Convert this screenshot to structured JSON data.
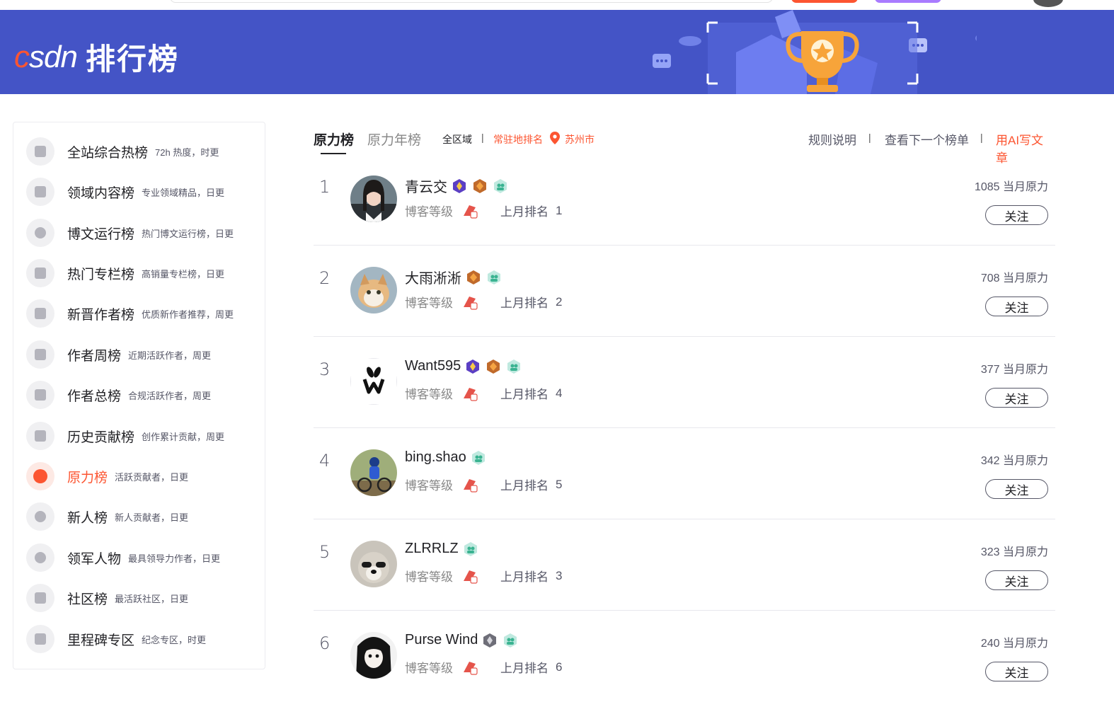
{
  "banner": {
    "logo_text": "CSDN",
    "title": "排行榜"
  },
  "sidebar": {
    "items": [
      {
        "label": "全站综合热榜",
        "desc": "72h 热度，时更",
        "icon": "rocket-icon"
      },
      {
        "label": "领域内容榜",
        "desc": "专业领域精品，日更",
        "icon": "code-icon"
      },
      {
        "label": "博文运行榜",
        "desc": "热门博文运行榜，日更",
        "icon": "play-icon"
      },
      {
        "label": "热门专栏榜",
        "desc": "高销量专栏榜，日更",
        "icon": "book-icon"
      },
      {
        "label": "新晋作者榜",
        "desc": "优质新作者推荐，周更",
        "icon": "user-icon"
      },
      {
        "label": "作者周榜",
        "desc": "近期活跃作者，周更",
        "icon": "calendar-icon"
      },
      {
        "label": "作者总榜",
        "desc": "合规活跃作者，周更",
        "icon": "group-icon"
      },
      {
        "label": "历史贡献榜",
        "desc": "创作累计贡献，周更",
        "icon": "podium-icon"
      },
      {
        "label": "原力榜",
        "desc": "活跃贡献者，日更",
        "icon": "new-badge-icon",
        "active": true
      },
      {
        "label": "新人榜",
        "desc": "新人贡献者，日更",
        "icon": "newcomer-icon"
      },
      {
        "label": "领军人物",
        "desc": "最具领导力作者，日更",
        "icon": "medal-icon"
      },
      {
        "label": "社区榜",
        "desc": "最活跃社区，日更",
        "icon": "community-icon"
      },
      {
        "label": "里程碑专区",
        "desc": "纪念专区，时更",
        "icon": "milestone-icon"
      }
    ]
  },
  "tabs": {
    "active": "原力榜",
    "second": "原力年榜",
    "filter_all": "全区域",
    "separator": "|",
    "filter_resident": "常驻地排名",
    "city": "苏州市",
    "rules": "规则说明",
    "next_list": "查看下一个榜单",
    "ai_write": "用AI写文章"
  },
  "labels": {
    "blog_level": "博客等级",
    "last_month_rank": "上月排名",
    "follow": "关注"
  },
  "colors": {
    "accent": "#fc5531",
    "banner": "#4454c6"
  },
  "rankings": [
    {
      "rank": "1",
      "name": "青云交",
      "badges": [
        "purple-badge",
        "orange-badge",
        "green-badge"
      ],
      "level_icon": "level-9-icon",
      "last_rank": "1",
      "force": "1085 当月原力"
    },
    {
      "rank": "2",
      "name": "大雨淅淅",
      "badges": [
        "orange-badge",
        "green-badge"
      ],
      "level_icon": "level-9-icon",
      "last_rank": "2",
      "force": "708 当月原力"
    },
    {
      "rank": "3",
      "name": "Want595",
      "badges": [
        "purple-badge",
        "orange-badge",
        "green-badge"
      ],
      "level_icon": "level-9-icon",
      "last_rank": "4",
      "force": "377 当月原力"
    },
    {
      "rank": "4",
      "name": "bing.shao",
      "badges": [
        "green-badge"
      ],
      "level_icon": "level-8-icon",
      "last_rank": "5",
      "force": "342 当月原力"
    },
    {
      "rank": "5",
      "name": "ZLRRLZ",
      "badges": [
        "green-badge"
      ],
      "level_icon": "level-6-icon",
      "last_rank": "3",
      "force": "323 当月原力"
    },
    {
      "rank": "6",
      "name": "Purse Wind",
      "badges": [
        "gray-badge",
        "green-badge"
      ],
      "level_icon": "level-5-icon",
      "last_rank": "6",
      "force": "240 当月原力"
    }
  ]
}
